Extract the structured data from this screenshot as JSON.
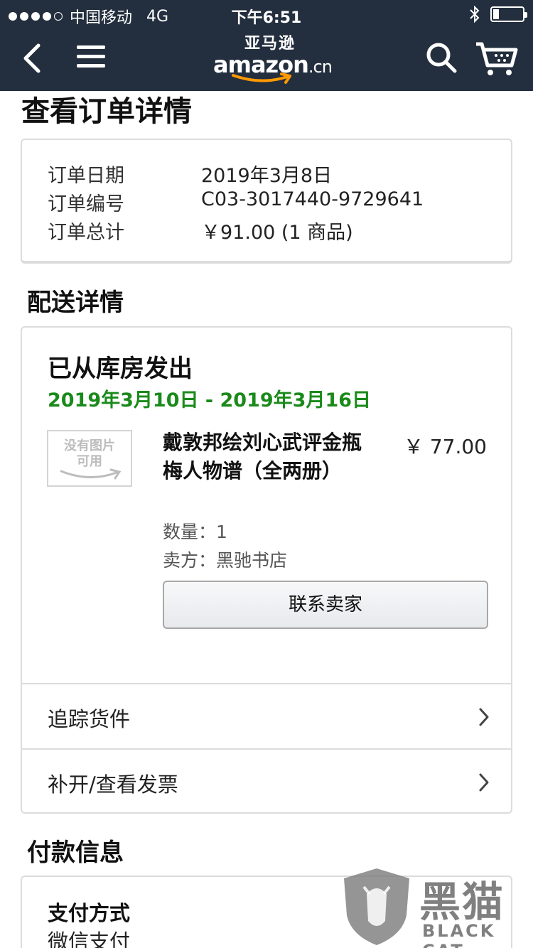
{
  "status_bar": {
    "carrier": "中国移动",
    "network": "4G",
    "time": "下午6:51"
  },
  "nav": {
    "logo_cn": "亚马逊",
    "logo_en": "amazon",
    "logo_suffix": ".cn"
  },
  "page": {
    "title": "查看订单详情"
  },
  "summary": {
    "date_label": "订单日期",
    "date_value": "2019年3月8日",
    "number_label": "订单编号",
    "number_value": "C03-3017440-9729641",
    "total_label": "订单总计",
    "total_value": "￥91.00 (1 商品)"
  },
  "delivery": {
    "section_title": "配送详情",
    "status": "已从库房发出",
    "date_range": "2019年3月10日 - 2019年3月16日",
    "item": {
      "image_placeholder_line1": "没有图片",
      "image_placeholder_line2": "可用",
      "title": "戴敦邦绘刘心武评金瓶梅人物谱（全两册）",
      "price": "￥ 77.00",
      "quantity": "数量：1",
      "seller": "卖方：黑驰书店",
      "contact_button": "联系卖家"
    },
    "track_label": "追踪货件",
    "invoice_label": "补开/查看发票"
  },
  "payment": {
    "section_title": "付款信息",
    "method_label": "支付方式",
    "method_value": "微信支付"
  },
  "watermark": {
    "cn": "黑猫",
    "en": "BLACK CAT"
  }
}
